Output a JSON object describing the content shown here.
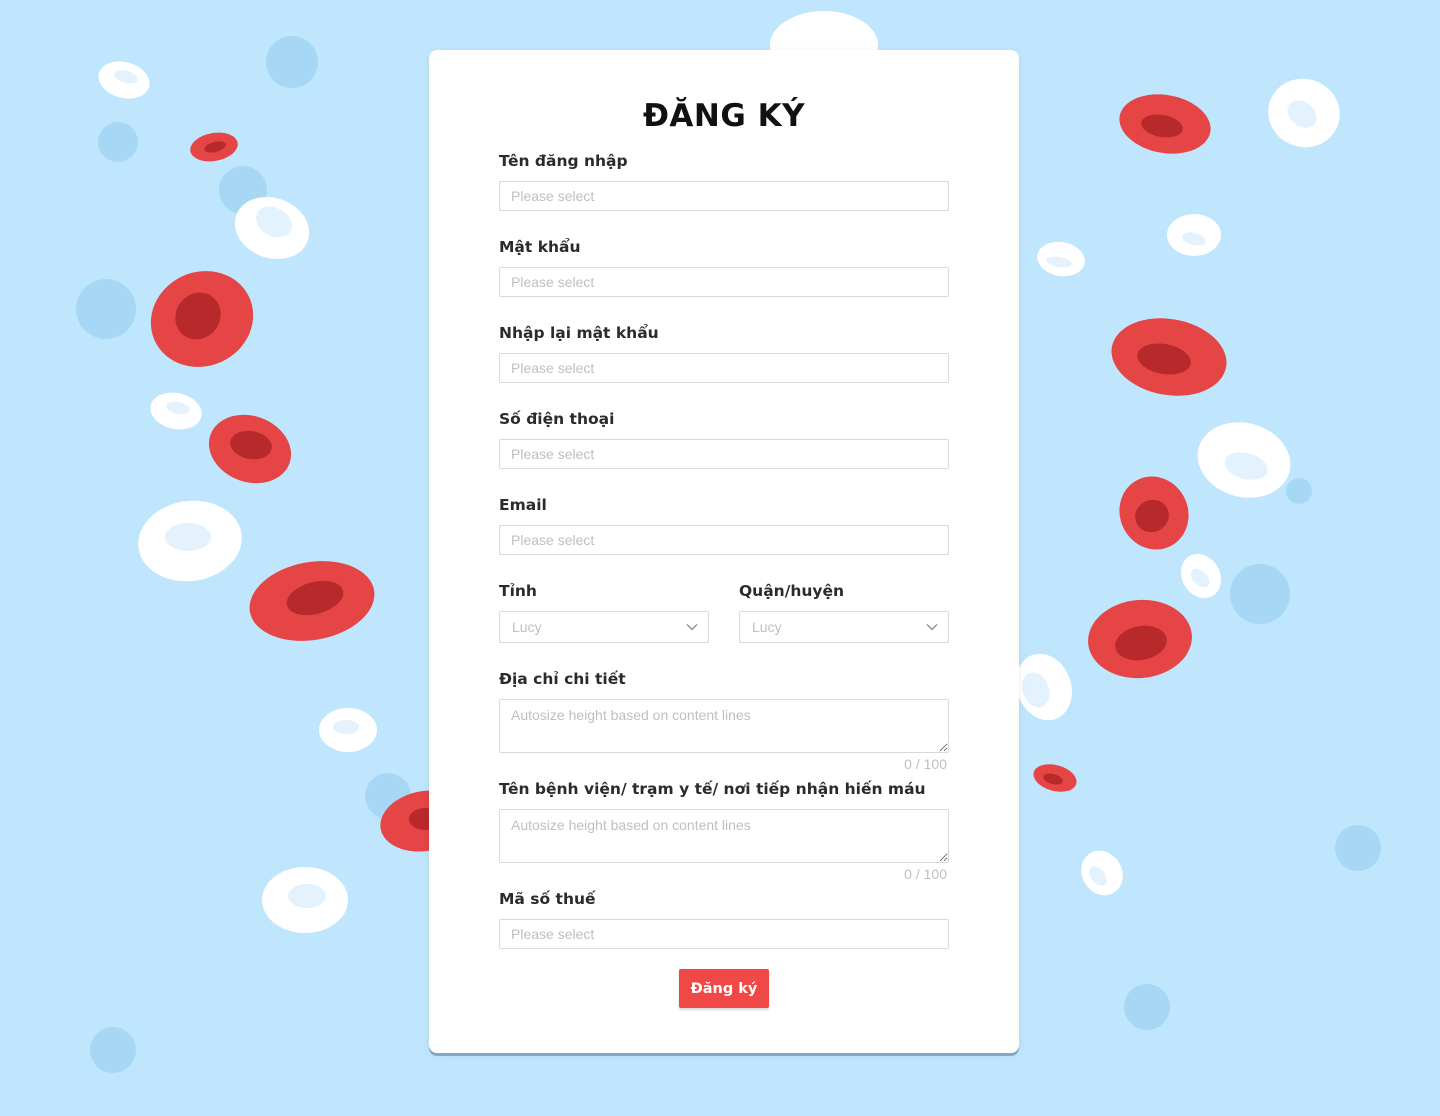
{
  "form": {
    "title": "ĐĂNG KÝ",
    "fields": {
      "username": {
        "label": "Tên đăng nhập",
        "placeholder": "Please select",
        "value": ""
      },
      "password": {
        "label": "Mật khẩu",
        "placeholder": "Please select",
        "value": ""
      },
      "confirm_password": {
        "label": "Nhập lại mật khẩu",
        "placeholder": "Please select",
        "value": ""
      },
      "phone": {
        "label": "Số điện thoại",
        "placeholder": "Please select",
        "value": ""
      },
      "email": {
        "label": "Email",
        "placeholder": "Please select",
        "value": ""
      },
      "province": {
        "label": "Tỉnh",
        "selected": "Lucy"
      },
      "district": {
        "label": "Quận/huyện",
        "selected": "Lucy"
      },
      "address": {
        "label": "Địa chỉ chi tiết",
        "placeholder": "Autosize height based on content lines",
        "counter": "0 / 100"
      },
      "hospital": {
        "label": "Tên bệnh viện/ trạm y tế/ nơi tiếp nhận hiến máu",
        "placeholder": "Autosize height based on content lines",
        "counter": "0 / 100"
      },
      "tax_code": {
        "label": "Mã số thuế",
        "placeholder": "Please select",
        "value": ""
      }
    },
    "submit_label": "Đăng ký"
  },
  "colors": {
    "background": "#bfe6fd",
    "red_cell": "#e54545",
    "red_cell_core": "#b8292c",
    "white_cell": "#ffffff",
    "white_cell_core": "#e3f2fd",
    "bubble": "#a6d8f5",
    "submit_button": "#f04747"
  }
}
